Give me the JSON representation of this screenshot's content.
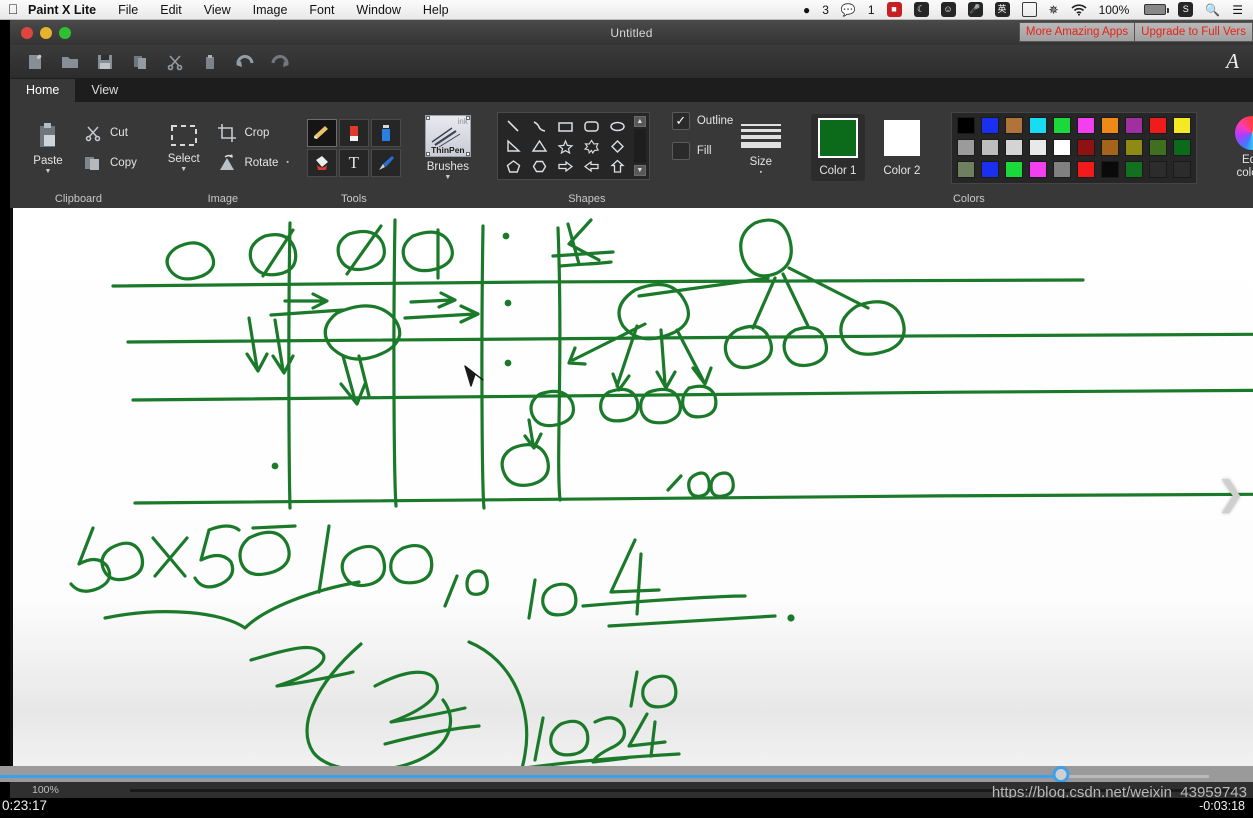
{
  "menubar": {
    "apple_icon": "apple-logo",
    "items": [
      {
        "label": "Paint X Lite",
        "bold": true
      },
      {
        "label": "File"
      },
      {
        "label": "Edit"
      },
      {
        "label": "View"
      },
      {
        "label": "Image"
      },
      {
        "label": "Font"
      },
      {
        "label": "Window"
      },
      {
        "label": "Help"
      }
    ],
    "tray": {
      "qq_count": "3",
      "wechat_count": "1",
      "battery_percent": "100%",
      "icons": [
        "qq-penguin-icon",
        "wechat-icon",
        "screen-recorder-icon",
        "moon-icon",
        "emoji-icon",
        "mic-icon",
        "ime-chinese-icon",
        "display-icon",
        "bluetooth-icon",
        "wifi-icon",
        "battery-icon",
        "sogou-icon",
        "spotlight-search-icon",
        "control-center-icon"
      ],
      "ime_label": "英",
      "bluetooth_glyph": "✳",
      "wifi_glyph": "wifi-icon",
      "search_glyph": "search-icon",
      "list_glyph": "list-icon"
    }
  },
  "window": {
    "title": "Untitled",
    "traffic_lights": [
      "close-button",
      "minimize-button",
      "zoom-button"
    ],
    "promo_buttons": [
      {
        "label": "More Amazing Apps"
      },
      {
        "label": "Upgrade to Full Vers"
      }
    ],
    "font_indicator": "A"
  },
  "quick_access": {
    "buttons": [
      {
        "name": "new-document-button",
        "glyph": "🗋"
      },
      {
        "name": "open-file-button",
        "glyph": "🗀"
      },
      {
        "name": "save-button",
        "glyph": "🖫"
      },
      {
        "name": "copy-button",
        "glyph": "🗐"
      },
      {
        "name": "cut-button",
        "glyph": "✂"
      },
      {
        "name": "paste-button",
        "glyph": "📋"
      },
      {
        "name": "undo-button",
        "glyph": "↶"
      },
      {
        "name": "redo-button",
        "glyph": "↷"
      }
    ]
  },
  "ribbon": {
    "tabs": [
      {
        "label": "Home",
        "active": true
      },
      {
        "label": "View",
        "active": false
      }
    ],
    "groups": {
      "clipboard": {
        "label": "Clipboard",
        "paste": "Paste",
        "cut": "Cut",
        "copy": "Copy"
      },
      "image": {
        "label": "Image",
        "select": "Select",
        "crop": "Crop",
        "rotate": "Rotate"
      },
      "tools": {
        "label": "Tools",
        "items": [
          {
            "name": "pencil-tool",
            "selected": true
          },
          {
            "name": "eraser-tool",
            "selected": false
          },
          {
            "name": "color-picker-tool",
            "selected": false
          },
          {
            "name": "fill-bucket-tool",
            "selected": false
          },
          {
            "name": "text-tool",
            "selected": false
          },
          {
            "name": "brush-tool",
            "selected": false
          }
        ]
      },
      "brushes": {
        "label": "Brushes",
        "preview_name": "ThinPen",
        "preview_ink": "ink"
      },
      "shapes": {
        "label": "Shapes",
        "items": [
          "line-shape",
          "curve-shape",
          "rectangle-shape",
          "rounded-rectangle-shape",
          "ellipse-shape",
          "right-triangle-shape",
          "triangle-shape",
          "star-5-shape",
          "star-6-shape",
          "diamond-shape",
          "pentagon-shape",
          "hexagon-shape",
          "right-arrow-shape",
          "left-arrow-shape",
          "up-arrow-shape"
        ]
      },
      "outline_fill": {
        "outline_label": "Outline",
        "outline_checked": true,
        "fill_label": "Fill",
        "fill_checked": false
      },
      "size": {
        "label": "Size"
      },
      "colors": {
        "label": "Colors",
        "color1_label": "Color 1",
        "color1_value": "#0b6b1a",
        "color2_label": "Color 2",
        "color2_value": "#ffffff",
        "edit_colors_label_line1": "Edit",
        "edit_colors_label_line2": "colors",
        "palette": [
          "#000000",
          "#1a2ff0",
          "#b0743a",
          "#17dcf2",
          "#1ad93a",
          "#f23ff0",
          "#f08a17",
          "#a030a0",
          "#ef1c1c",
          "#f5e924",
          "#9b9b9b",
          "#bdbdbd",
          "#d4d4d4",
          "#e9e9e9",
          "#ffffff",
          "#8f1111",
          "#a5641a",
          "#8f8a14",
          "#3f7020",
          "#0b6b1a",
          "#6f8060",
          "#1a2ff0",
          "#1ad93a",
          "#f23ff0",
          "#808080",
          "#f21a1a",
          "#0a0a0a",
          "#13701f",
          "#2c2c2c",
          "#2c2c2c"
        ]
      }
    }
  },
  "canvas": {
    "name": "drawing-canvas",
    "stroke_color": "#1a7a2a",
    "next_arrow": "❯"
  },
  "status": {
    "zoom_level": "100%"
  },
  "player": {
    "elapsed": "0:23:17",
    "remaining": "-0:03:18",
    "progress_percent": 84.7,
    "buffer_percent": 96.5,
    "watermark": "https://blog.csdn.net/weixin_43959743"
  }
}
